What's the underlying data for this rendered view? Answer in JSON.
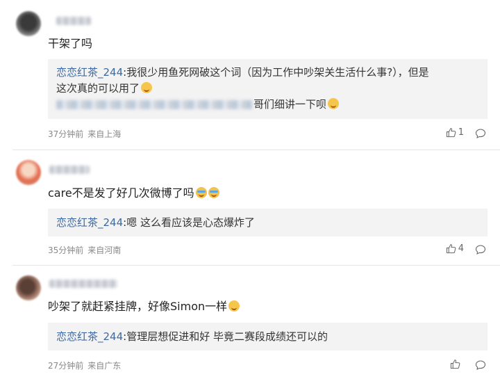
{
  "comments": [
    {
      "text": "干架了吗",
      "reply": {
        "user": "恋恋红茶_244",
        "line1": ":我很少用鱼死网破这个词（因为工作中吵架关生活什么事?），但是",
        "line2a": "这次真的可以用了",
        "line3_tail": "哥们细讲一下呗"
      },
      "time": "37分钟前",
      "location": "来自上海",
      "likes": "1"
    },
    {
      "text": "care不是发了好几次微博了吗",
      "reply": {
        "user": "恋恋红茶_244",
        "line1": ":嗯 这么看应该是心态爆炸了"
      },
      "time": "35分钟前",
      "location": "来自河南",
      "likes": "4"
    },
    {
      "text": "吵架了就赶紧挂牌，好像Simon一样",
      "reply": {
        "user": "恋恋红茶_244",
        "line1": ":管理层想促进和好 毕竟二赛段成绩还可以的"
      },
      "time": "27分钟前",
      "location": "来自广东",
      "likes": ""
    }
  ],
  "icons": {
    "like": "thumbs-up-icon",
    "reply": "comment-bubble-icon"
  }
}
